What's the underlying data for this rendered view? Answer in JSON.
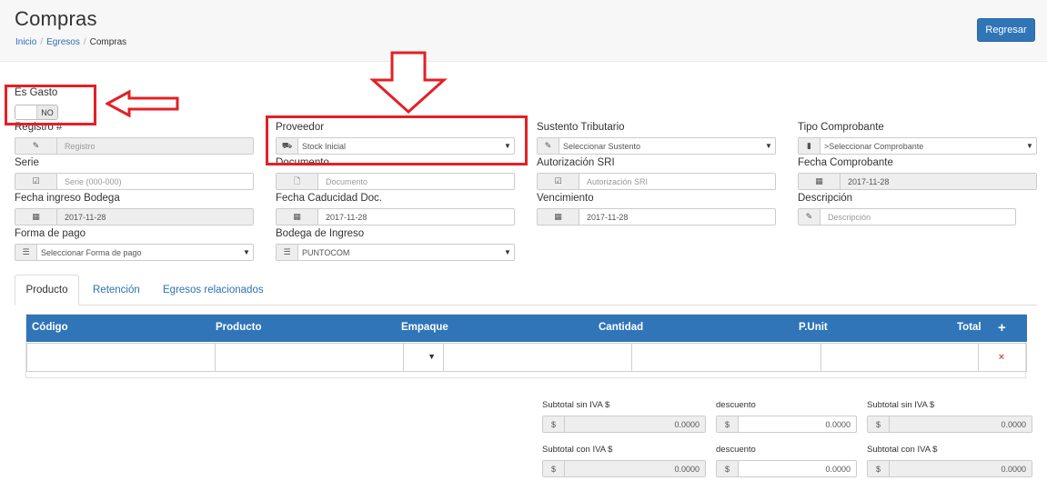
{
  "header": {
    "title": "Compras",
    "breadcrumb": [
      "Inicio",
      "Egresos",
      "Compras"
    ],
    "back_button": "Regresar"
  },
  "es_gasto": {
    "label": "Es Gasto",
    "state": "NO"
  },
  "form": {
    "registro": {
      "label": "Registro #",
      "placeholder": "Registro"
    },
    "proveedor": {
      "label": "Proveedor",
      "value": "Stock Inicial"
    },
    "sustento": {
      "label": "Sustento Tributario",
      "value": "Seleccionar Sustento"
    },
    "tipo_comprobante": {
      "label": "Tipo Comprobante",
      "value": ">Seleccionar Comprobante"
    },
    "serie": {
      "label": "Serie",
      "placeholder": "Serie (000-000)"
    },
    "documento": {
      "label": "Documento",
      "placeholder": "Documento"
    },
    "autorizacion": {
      "label": "Autorización SRI",
      "placeholder": "Autorización SRI"
    },
    "fecha_comprobante": {
      "label": "Fecha Comprobante",
      "value": "2017-11-28"
    },
    "fecha_ingreso": {
      "label": "Fecha ingreso Bodega",
      "value": "2017-11-28"
    },
    "fecha_caducidad": {
      "label": "Fecha Caducidad Doc.",
      "value": "2017-11-28"
    },
    "vencimiento": {
      "label": "Vencimiento",
      "value": "2017-11-28"
    },
    "descripcion": {
      "label": "Descripción",
      "placeholder": "Descripción"
    },
    "forma_pago": {
      "label": "Forma de pago",
      "value": "Seleccionar Forma de pago"
    },
    "bodega": {
      "label": "Bodega de Ingreso",
      "value": "PUNTOCOM"
    }
  },
  "tabs": [
    "Producto",
    "Retención",
    "Egresos relacionados"
  ],
  "table": {
    "columns": [
      "Código",
      "Producto",
      "Empaque",
      "Cantidad",
      "P.Unit",
      "Total"
    ],
    "add_symbol": "+",
    "remove_symbol": "×",
    "caret": "▼"
  },
  "totals": {
    "row1": [
      {
        "label": "Subtotal sin IVA $",
        "value": "0.0000"
      },
      {
        "label": "descuento",
        "value": "0.0000"
      },
      {
        "label": "Subtotal sin IVA $",
        "value": "0.0000"
      }
    ],
    "row2": [
      {
        "label": "Subtotal con IVA $",
        "value": "0.0000"
      },
      {
        "label": "descuento",
        "value": "0.0000"
      },
      {
        "label": "Subtotal con IVA $",
        "value": "0.0000"
      }
    ],
    "currency": "$"
  },
  "icons": {
    "pencil": "✎",
    "truck": "⛟",
    "edit": "✎",
    "file": "▮",
    "checkbox": "☑",
    "doc": "🗋",
    "calendar": "▦",
    "list": "☰",
    "caret": "▼"
  },
  "colors": {
    "primary": "#3075b8",
    "annotation": "#e32026",
    "link": "#2f6fb5"
  }
}
